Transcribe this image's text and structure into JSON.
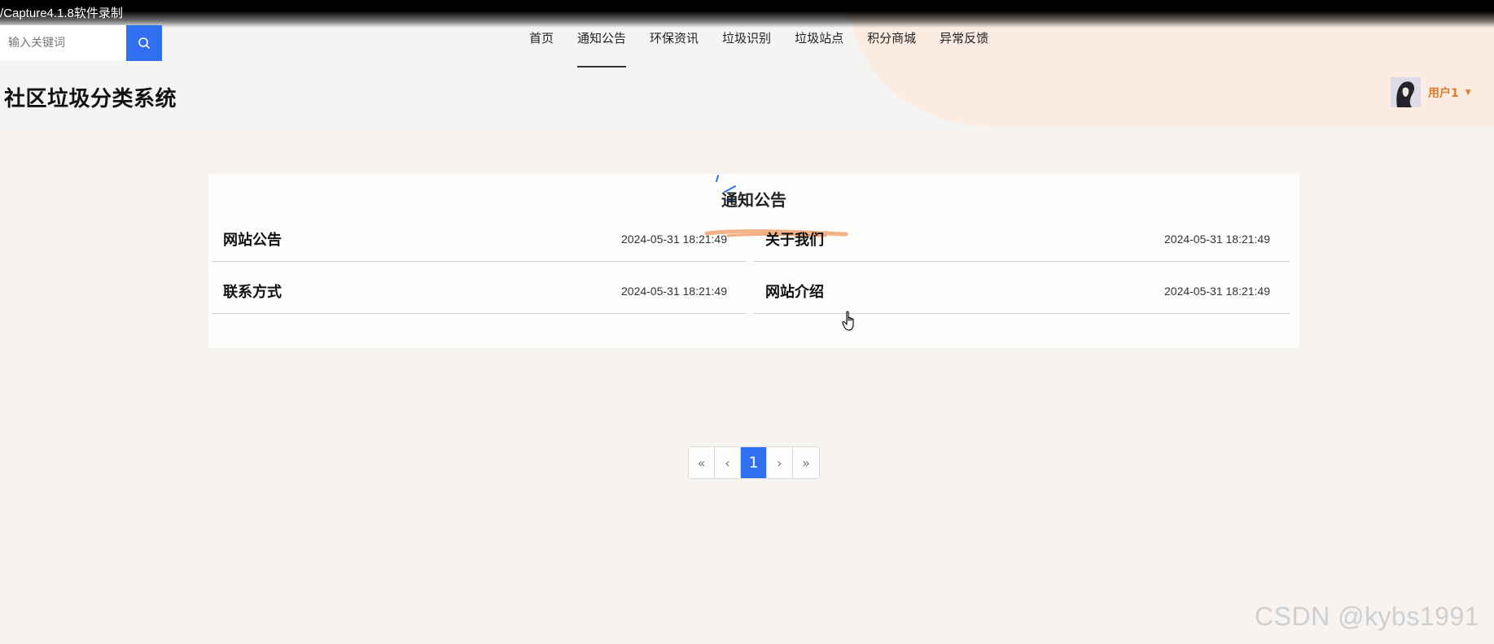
{
  "capture": {
    "label": "/Capture4.1.8软件录制"
  },
  "search": {
    "placeholder": "输入关键词",
    "button_icon": "search-icon"
  },
  "nav": {
    "items": [
      {
        "label": "首页"
      },
      {
        "label": "通知公告"
      },
      {
        "label": "环保资讯"
      },
      {
        "label": "垃圾识别"
      },
      {
        "label": "垃圾站点"
      },
      {
        "label": "积分商城"
      },
      {
        "label": "异常反馈"
      }
    ],
    "active": "通知公告"
  },
  "site": {
    "title": "社区垃圾分类系统"
  },
  "user": {
    "name": "用户1",
    "avatar_icon": "avatar-icon"
  },
  "panel": {
    "title": "通知公告",
    "notices": [
      {
        "title": "网站公告",
        "date": "2024-05-31 18:21:49"
      },
      {
        "title": "关于我们",
        "date": "2024-05-31 18:21:49"
      },
      {
        "title": "联系方式",
        "date": "2024-05-31 18:21:49"
      },
      {
        "title": "网站介绍",
        "date": "2024-05-31 18:21:49"
      }
    ]
  },
  "pagination": {
    "first": "«",
    "prev": "‹",
    "current": "1",
    "next": "›",
    "last": "»"
  },
  "watermark": "CSDN @kybs1991",
  "colors": {
    "accent": "#2f6ff0",
    "user": "#e07b2c",
    "blob": "#fcebe0"
  }
}
